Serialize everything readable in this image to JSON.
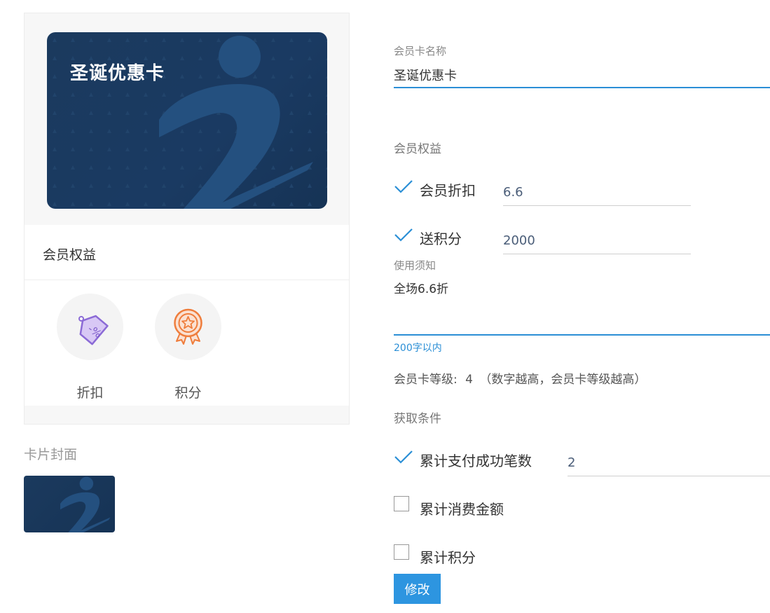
{
  "card": {
    "title": "圣诞优惠卡"
  },
  "preview": {
    "benefits_heading": "会员权益",
    "benefits": [
      {
        "label": "折扣",
        "icon": "discount-tag-icon"
      },
      {
        "label": "积分",
        "icon": "points-medal-icon"
      }
    ],
    "cover_heading": "卡片封面"
  },
  "form": {
    "name_label": "会员卡名称",
    "name_value": "圣诞优惠卡",
    "rights_label": "会员权益",
    "discount_label": "会员折扣",
    "discount_value": "6.6",
    "points_label": "送积分",
    "points_value": "2000",
    "notice_label": "使用须知",
    "notice_value": "全场6.6折",
    "notice_hint": "200字以内",
    "level_label": "会员卡等级:",
    "level_value": "4",
    "level_note": "（数字越高，会员卡等级越高）",
    "conditions_label": "获取条件",
    "conditions": [
      {
        "label": "累计支付成功笔数",
        "checked": true,
        "value": "2"
      },
      {
        "label": "累计消费金额",
        "checked": false
      },
      {
        "label": "累计积分",
        "checked": false
      }
    ],
    "submit_label": "修改"
  },
  "colors": {
    "accent": "#2b8fd6",
    "card_bg": "#1b3a5e",
    "button": "#2d95e0"
  }
}
